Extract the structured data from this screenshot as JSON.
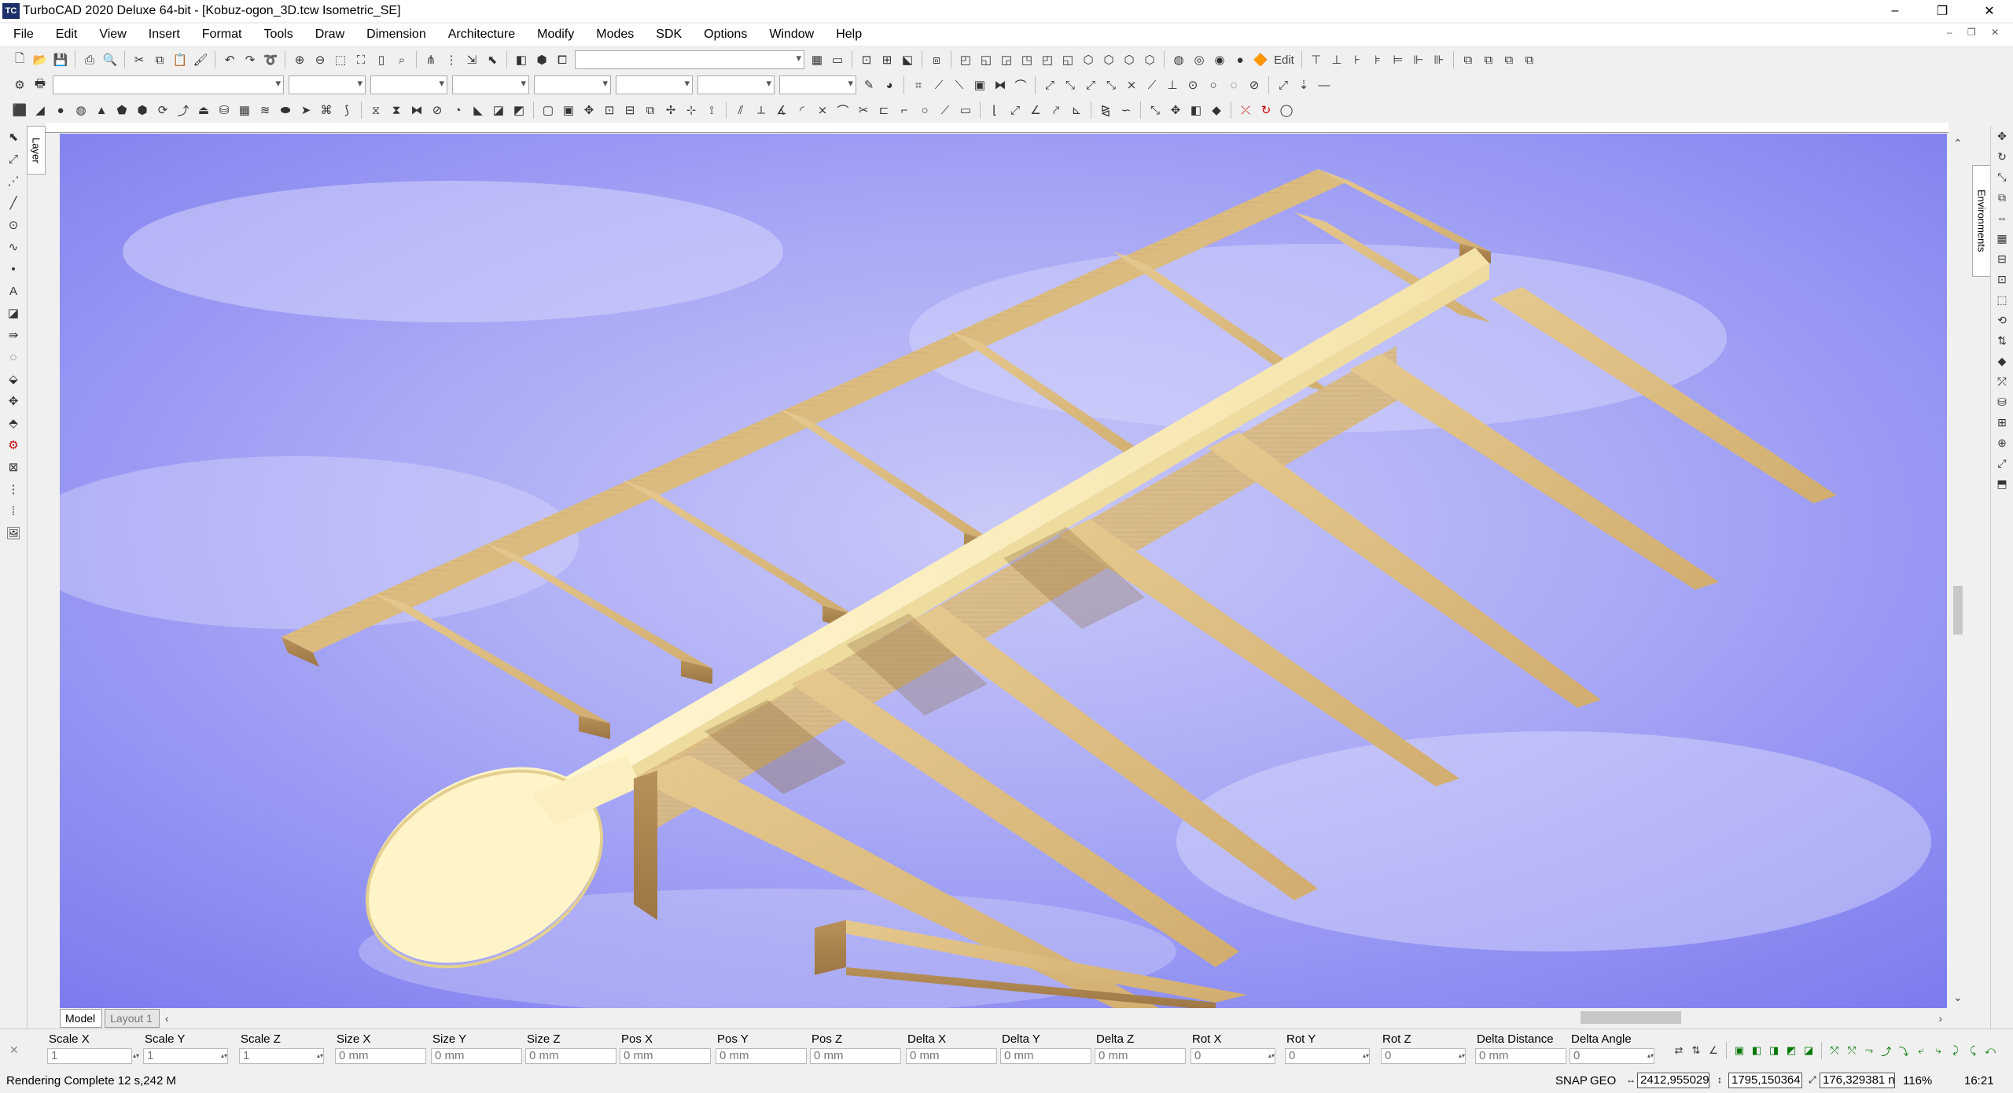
{
  "window": {
    "app_icon_text": "TC",
    "title": "TurboCAD 2020 Deluxe 64-bit - [Kobuz-ogon_3D.tcw Isometric_SE]",
    "buttons": [
      "–",
      "❐",
      "✕"
    ]
  },
  "menu": [
    "File",
    "Edit",
    "View",
    "Insert",
    "Format",
    "Tools",
    "Draw",
    "Dimension",
    "Architecture",
    "Modify",
    "Modes",
    "SDK",
    "Options",
    "Window",
    "Help"
  ],
  "menu_right_controls": "– ❐ ✕",
  "toolbar": {
    "edit_label": "Edit"
  },
  "layer_tab": "Layer",
  "environments_tab": "Environments",
  "tabs": {
    "model": "Model",
    "layout": "Layout 1"
  },
  "coordinates": [
    {
      "label": "Scale X",
      "value": "1"
    },
    {
      "label": "Scale Y",
      "value": "1"
    },
    {
      "label": "Scale Z",
      "value": "1"
    },
    {
      "label": "Size X",
      "value": "0 mm"
    },
    {
      "label": "Size Y",
      "value": "0 mm"
    },
    {
      "label": "Size Z",
      "value": "0 mm"
    },
    {
      "label": "Pos X",
      "value": "0 mm"
    },
    {
      "label": "Pos Y",
      "value": "0 mm"
    },
    {
      "label": "Pos Z",
      "value": "0 mm"
    },
    {
      "label": "Delta X",
      "value": "0 mm"
    },
    {
      "label": "Delta Y",
      "value": "0 mm"
    },
    {
      "label": "Delta Z",
      "value": "0 mm"
    },
    {
      "label": "Rot X",
      "value": "0"
    },
    {
      "label": "Rot Y",
      "value": "0"
    },
    {
      "label": "Rot Z",
      "value": "0"
    },
    {
      "label": "Delta Distance",
      "value": "0 mm"
    },
    {
      "label": "Delta Angle",
      "value": "0"
    }
  ],
  "status": {
    "message": "Rendering Complete 12 s,242 M",
    "snap": "SNAP",
    "geo": "GEO",
    "x": "2412,955029",
    "y": "1795,150364",
    "z": "176,329381 n",
    "zoom": "116%",
    "time": "16:21"
  }
}
